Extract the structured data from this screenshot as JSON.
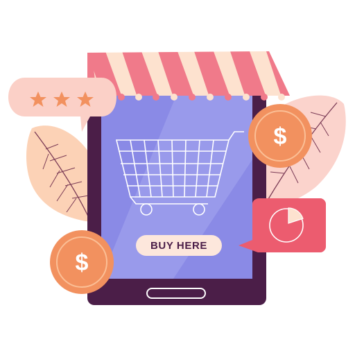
{
  "buy_button": {
    "label": "BUY HERE"
  },
  "currency_symbol": "$",
  "rating": {
    "stars_shown": 3
  },
  "pie_chart": {
    "highlighted_fraction": 0.2
  },
  "icons": {
    "cart": "shopping-cart-icon",
    "coin": "dollar-coin-icon",
    "star": "star-icon",
    "pie": "pie-chart-icon"
  },
  "colors": {
    "tablet_frame": "#4b1e48",
    "screen": "#8a8ae6",
    "awning_pink": "#f07a8a",
    "awning_cream": "#fde2cf",
    "coin": "#f2915f",
    "coin_ring": "#fbbf96",
    "speech_bubble": "#fbd0c7",
    "star": "#f2915f",
    "chart_card": "#ec5c6f",
    "leaf_peach": "#fcd2b6",
    "leaf_pink": "#fbd3cc",
    "button": "#fde7dc",
    "button_text": "#4b1e48"
  }
}
